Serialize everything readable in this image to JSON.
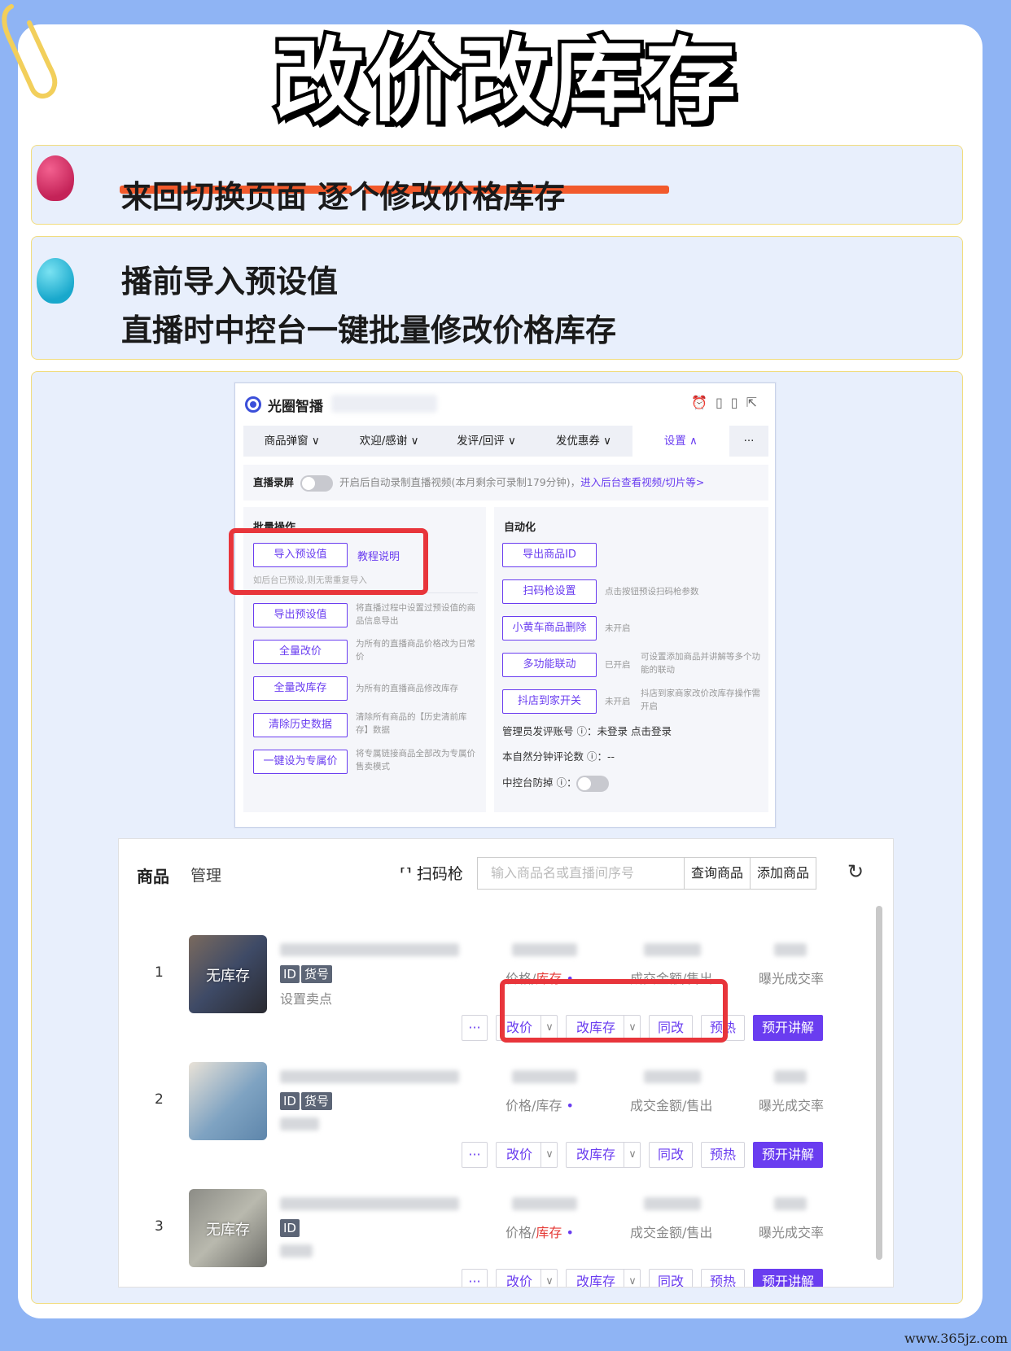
{
  "title": "改价改库存",
  "pain_point": "来回切换页面  逐个修改价格库存",
  "solution_line1": "播前导入预设值",
  "solution_line2": "直播时中控台一键批量修改价格库存",
  "console": {
    "app_name": "光圈智播",
    "tabs": [
      "商品弹窗 ∨",
      "欢迎/感谢 ∨",
      "发评/回评 ∨",
      "发优惠券 ∨",
      "设置 ∧",
      "···"
    ],
    "record": {
      "label": "直播录屏",
      "text": "开启后自动录制直播视频(本月剩余可录制179分钟)，",
      "link": "进入后台查看视频/切片等>"
    },
    "batch": {
      "title": "批量操作",
      "import_button": "导入预设值",
      "tutorial_link": "教程说明",
      "import_hint": "如后台已预设,则无需重复导入",
      "actions": [
        {
          "label": "导出预设值",
          "desc": "将直播过程中设置过预设值的商品信息导出"
        },
        {
          "label": "全量改价",
          "desc": "为所有的直播商品价格改为日常价"
        },
        {
          "label": "全量改库存",
          "desc": "为所有的直播商品修改库存"
        },
        {
          "label": "清除历史数据",
          "desc": "清除所有商品的【历史清前库存】数据"
        },
        {
          "label": "一键设为专属价",
          "desc": "将专属链接商品全部改为专属价售卖模式"
        }
      ]
    },
    "auto": {
      "title": "自动化",
      "actions": [
        {
          "label": "导出商品ID",
          "status": "",
          "desc": ""
        },
        {
          "label": "扫码枪设置",
          "status": "",
          "desc": "点击按钮预设扫码枪参数"
        },
        {
          "label": "小黄车商品删除",
          "status": "未开启",
          "desc": ""
        },
        {
          "label": "多功能联动",
          "status": "已开启",
          "desc": "可设置添加商品并讲解等多个功能的联动"
        },
        {
          "label": "抖店到家开关",
          "status": "未开启",
          "desc": "抖店到家商家改价改库存操作需开启"
        }
      ],
      "admin_account": "管理员发评账号 ⓘ：未登录 点击登录",
      "natural_comments": "本自然分钟评论数 ⓘ：--",
      "anti_drop": "中控台防掉 ⓘ："
    }
  },
  "products": {
    "tab_products": "商品",
    "tab_manage": "管理",
    "scan_label": "扫码枪",
    "search_placeholder": "输入商品名或直播间序号",
    "query_button": "查询商品",
    "add_button": "添加商品",
    "rows": [
      {
        "index": "1",
        "thumb_label": "无库存",
        "tags": [
          "ID",
          "货号"
        ],
        "sell_point": "设置卖点",
        "price_label": "价格/",
        "stock_label": "库存",
        "amount_label": "成交金额/售出",
        "rate_label": "曝光成交率"
      },
      {
        "index": "2",
        "thumb_label": "",
        "tags": [
          "ID",
          "货号"
        ],
        "sell_point": "",
        "price_label": "价格/库存",
        "stock_label": "",
        "amount_label": "成交金额/售出",
        "rate_label": "曝光成交率"
      },
      {
        "index": "3",
        "thumb_label": "无库存",
        "tags": [
          "ID"
        ],
        "sell_point": "",
        "price_label": "价格/",
        "stock_label": "库存",
        "amount_label": "成交金额/售出",
        "rate_label": "曝光成交率"
      }
    ],
    "actions": {
      "more": "···",
      "price": "改价",
      "stock": "改库存",
      "same": "同改",
      "preheat": "预热",
      "explain": "预开讲解"
    }
  },
  "watermark": "www.365jz.com",
  "colors": {
    "accent": "#6a3df0",
    "highlight": "#e8353b",
    "background": "#8fb4f4"
  }
}
